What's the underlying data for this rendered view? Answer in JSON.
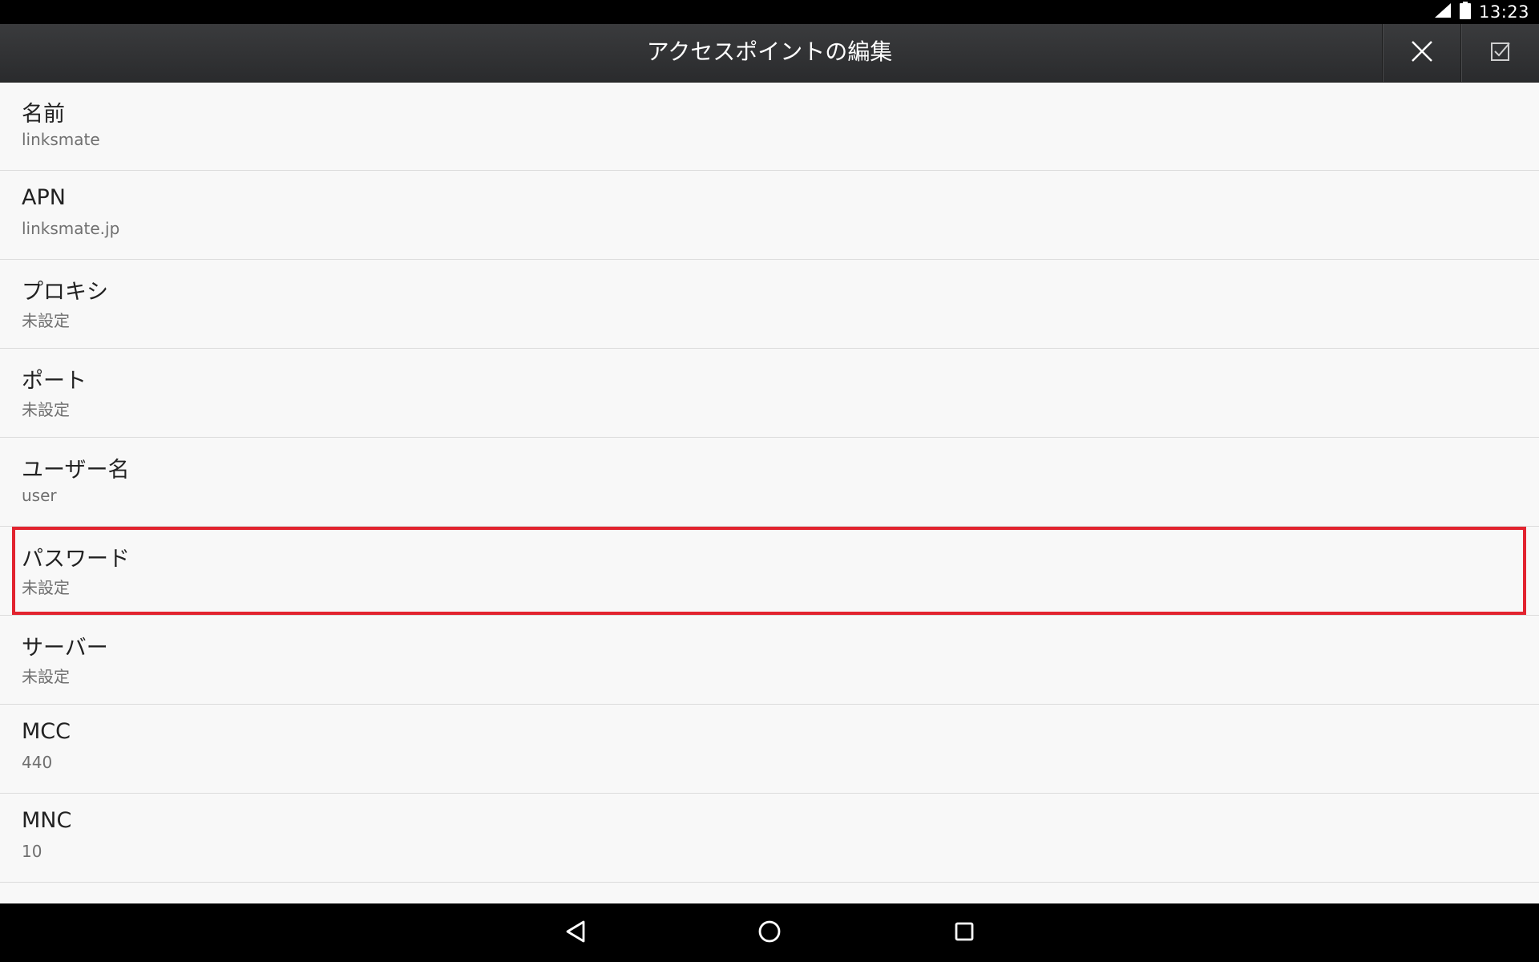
{
  "status_bar": {
    "time": "13:23",
    "icons": [
      "signal-icon",
      "battery-icon"
    ]
  },
  "toolbar": {
    "title": "アクセスポイントの編集",
    "close_icon": "close-icon",
    "save_icon": "checkbox-save-icon"
  },
  "fields": [
    {
      "title": "名前",
      "value": "linksmate"
    },
    {
      "title": "APN",
      "value": "linksmate.jp"
    },
    {
      "title": "プロキシ",
      "value": "未設定"
    },
    {
      "title": "ポート",
      "value": "未設定"
    },
    {
      "title": "ユーザー名",
      "value": "user"
    },
    {
      "title": "パスワード",
      "value": "未設定"
    },
    {
      "title": "サーバー",
      "value": "未設定"
    },
    {
      "title": "MCC",
      "value": "440"
    },
    {
      "title": "MNC",
      "value": "10"
    }
  ],
  "highlight": {
    "target": "パスワード",
    "color": "#e2232f"
  },
  "navigation": {
    "icons": [
      "back-icon",
      "home-icon",
      "recent-apps-icon"
    ]
  },
  "colors": {
    "toolbar_bg": "#2f3032",
    "list_bg": "#f8f8f8",
    "divider": "#dcdcdc",
    "highlight": "#e2232f"
  }
}
